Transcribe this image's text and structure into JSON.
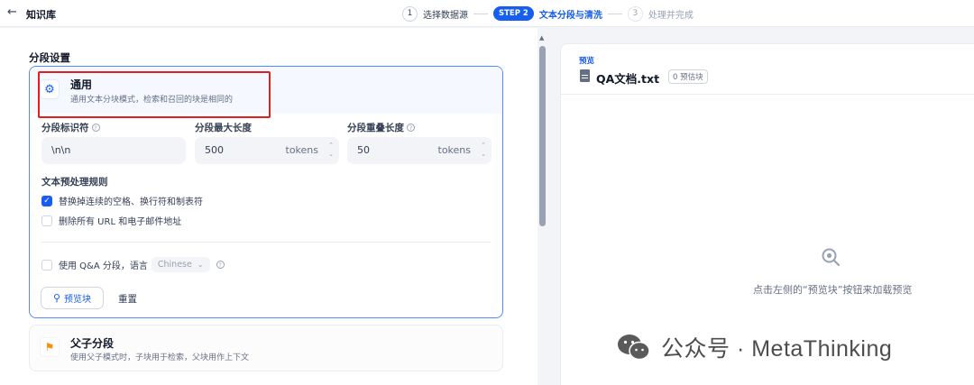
{
  "header": {
    "back_icon": "arrow-left-icon",
    "title": "知识库",
    "steps": [
      {
        "num": "1",
        "label": "选择数据源"
      },
      {
        "num": "STEP 2",
        "label": "文本分段与清洗"
      },
      {
        "num": "3",
        "label": "处理并完成"
      }
    ]
  },
  "left": {
    "section_title": "分段设置",
    "general": {
      "icon": "gear-icon",
      "title": "通用",
      "desc": "通用文本分块模式，检索和召回的块是相同的"
    },
    "fields": [
      {
        "label": "分段标识符",
        "value": "\\n\\n",
        "unit": ""
      },
      {
        "label": "分段最大长度",
        "value": "500",
        "unit": "tokens"
      },
      {
        "label": "分段重叠长度",
        "value": "50",
        "unit": "tokens"
      }
    ],
    "rules_title": "文本预处理规则",
    "rules": [
      {
        "label": "替换掉连续的空格、换行符和制表符",
        "checked": true
      },
      {
        "label": "删除所有 URL 和电子邮件地址",
        "checked": false
      }
    ],
    "qa": {
      "label": "使用 Q&A 分段，语言",
      "language": "Chinese",
      "checked": false
    },
    "preview_button": "预览块",
    "reset_button": "重置",
    "parent_child": {
      "icon": "parent-child-icon",
      "title": "父子分段",
      "desc": "使用父子模式时，子块用于检索，父块用作上下文"
    }
  },
  "right": {
    "small_label": "预览",
    "file_name": "QA文档.txt",
    "badge": "0 预估块",
    "empty_text": "点击左侧的“预览块”按钮来加载预览"
  },
  "watermark": "公众号 · MetaThinking",
  "colors": {
    "accent": "#155eef",
    "highlight": "#e02020",
    "border_active": "#528bff"
  }
}
